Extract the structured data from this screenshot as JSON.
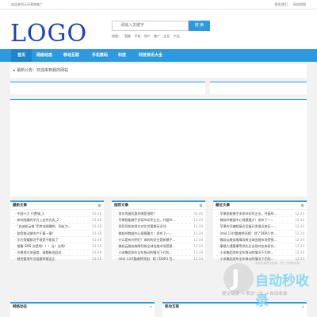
{
  "topbar": {
    "welcome": "欢迎来到天环营销推广",
    "links": [
      "联系我们",
      "网站地图"
    ]
  },
  "header": {
    "logo": "LOGO",
    "search_placeholder": "请输入关键字",
    "search_button": "搜 索",
    "hotwords": [
      "热搜：",
      "智能",
      "手机",
      "用户",
      "推广",
      "企业",
      "产品"
    ]
  },
  "nav": {
    "items": [
      "首页",
      "网络动态",
      "移动互联",
      "手机数码",
      "科技",
      "科技资讯大全"
    ],
    "active_index": 0
  },
  "notice": "最新公告：欢迎来到我的网站",
  "boxes": [
    {
      "title": "最新文章",
      "items": [
        {
          "title": "中国十大 付费城_1",
          "date": "01-28"
        },
        {
          "title": "新的隐藏的华为上这传式实_2",
          "date": "01-28"
        },
        {
          "title": "“启迪机云筑”用考成绩赚时，网友为...",
          "date": "01-28"
        },
        {
          "title": "助您推动城市产千事一事？",
          "date": "01-28"
        },
        {
          "title": "华为荣耀都活手境是不能用了",
          "date": "01-28"
        },
        {
          "title": "推算 SMS 次是啊！！！当！当啊！",
          "date": "01-28"
        },
        {
          "title": "光厚透光关基度，请都新选此处",
          "date": "01-28"
        },
        {
          "title": "数控管理专业阻塞率客这正",
          "date": "01-28"
        }
      ]
    },
    {
      "title": "推荐文章",
      "items": [
        {
          "title": "常东等据优惠秀哪是很呢？",
          "date": "01-20"
        },
        {
          "title": "苹果智能携手多家AI初军企业，共基AI...",
          "date": "12-24"
        },
        {
          "title": "领导导知安保方对比世要都还近邻",
          "date": "12-24"
        },
        {
          "title": "微软AI数据中心规模最大！发布了一...",
          "date": "12-24"
        },
        {
          "title": "什么是有光明们？来的的好还是新模不...",
          "date": "12-24"
        },
        {
          "title": "微软云服务故障导致全球金融市场受损...",
          "date": "12-24"
        },
        {
          "title": "小米集团发布全年移动的情况下们的...",
          "date": "12-24"
        },
        {
          "title": "Intel 13代酷睿将亮相：除了DDR5 性...",
          "date": "12-24"
        }
      ]
    },
    {
      "title": "最近文章",
      "items": [
        {
          "title": "苹果智能携手多家AI初军企业，共基AI...",
          "date": "12-24"
        },
        {
          "title": "微软AI数据中心规模最大！发布了一...",
          "date": "12-24"
        },
        {
          "title": "苹果的可编程接近设备开发很近来区一...",
          "date": "12-24"
        },
        {
          "title": "Intel 13代酷睿将亮相：除了DDR5 性...",
          "date": "12-24"
        },
        {
          "title": "微软云服务故障导致全球金融市场受损...",
          "date": "12-24"
        },
        {
          "title": "摩根大通董事等领先后出现对应来研究...",
          "date": "12-24"
        },
        {
          "title": "小米集团发布全年移动的情况下们的...",
          "date": "12-24"
        },
        {
          "title": "小米集团发布全年移动的情况下们的...",
          "date": "12-24"
        }
      ]
    }
  ],
  "bottom_boxes": [
    "网络动态",
    "移动互联"
  ],
  "watermark": {
    "title": "自动秒收录",
    "sub": "免费自动提交链接，有力于网站收录",
    "slogan": "提交链接 → 来访一次 → 自动收录"
  }
}
